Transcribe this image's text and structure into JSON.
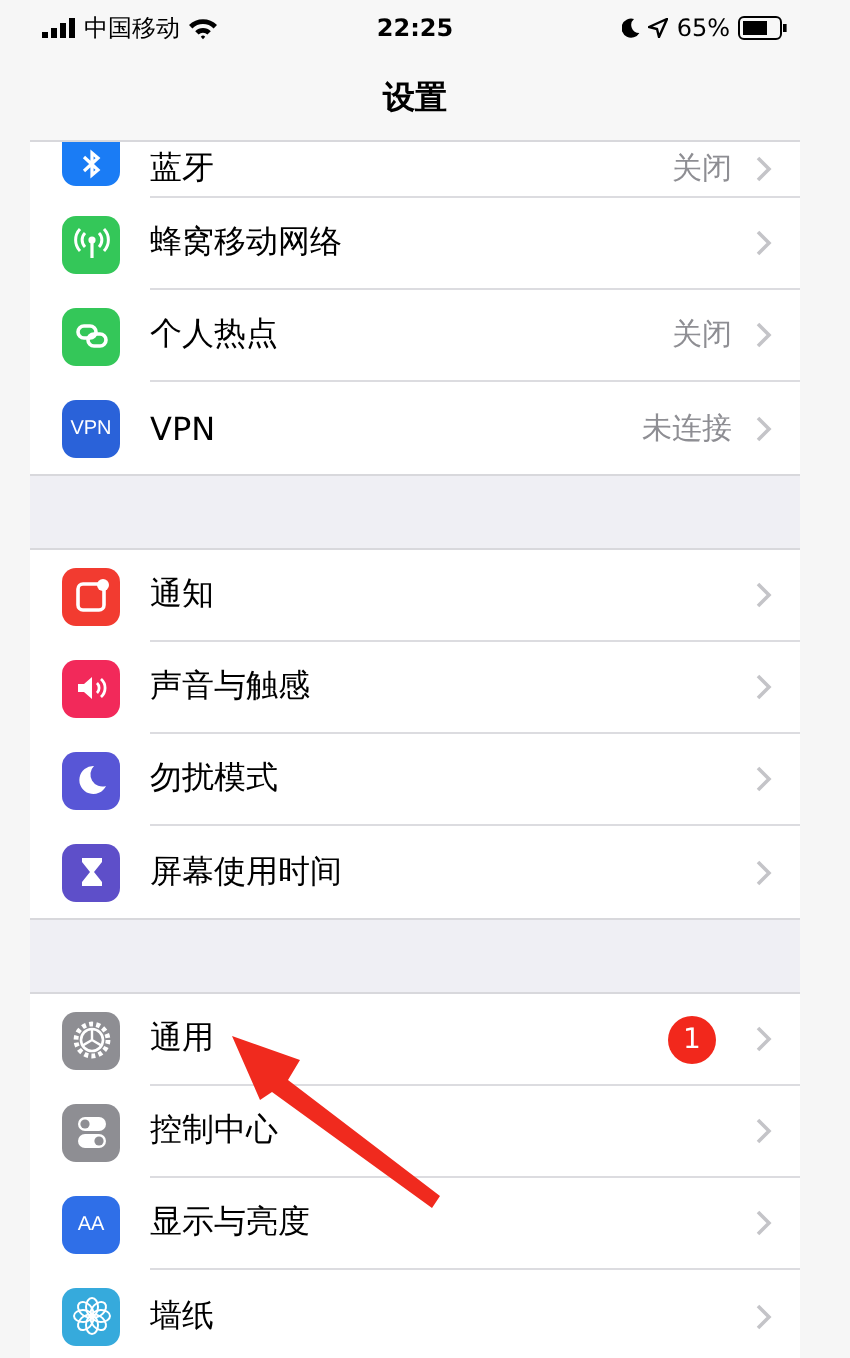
{
  "status_bar": {
    "carrier": "中国移动",
    "time": "22:25",
    "battery": "65%"
  },
  "title": "设置",
  "sections": [
    {
      "rows": [
        {
          "color": "#1a7cf5",
          "label": "蓝牙",
          "value": "关闭"
        },
        {
          "color": "#34c759",
          "label": "蜂窝移动网络"
        },
        {
          "color": "#34c759",
          "label": "个人热点",
          "value": "关闭"
        },
        {
          "icon_text": "VPN",
          "color": "#2a62d9",
          "label": "VPN",
          "value": "未连接"
        }
      ]
    },
    {
      "rows": [
        {
          "color": "#f23b30",
          "label": "通知"
        },
        {
          "color": "#f2295a",
          "label": "声音与触感"
        },
        {
          "color": "#5856d6",
          "label": "勿扰模式"
        },
        {
          "color": "#5e4fc9",
          "label": "屏幕使用时间"
        }
      ]
    },
    {
      "rows": [
        {
          "color": "#8e8e93",
          "label": "通用",
          "badge": "1"
        },
        {
          "color": "#8e8e93",
          "label": "控制中心"
        },
        {
          "icon_text": "AA",
          "color": "#2f6fe8",
          "label": "显示与亮度"
        },
        {
          "color": "#36aadc",
          "label": "墙纸"
        }
      ]
    }
  ],
  "annotation": {
    "kind": "arrow",
    "color": "#f02a1e"
  }
}
